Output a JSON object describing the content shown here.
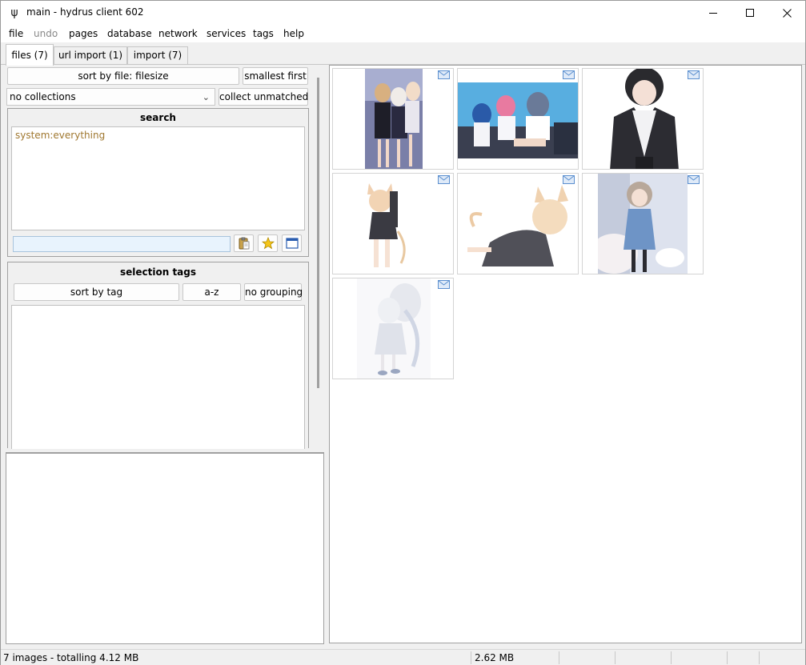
{
  "window": {
    "title": "main - hydrus client 602"
  },
  "menu": [
    "file",
    "undo",
    "pages",
    "database",
    "network",
    "services",
    "tags",
    "help"
  ],
  "tabs": [
    {
      "label": "files (7)",
      "active": true
    },
    {
      "label": "url import (1)",
      "active": false
    },
    {
      "label": "import (7)",
      "active": false
    }
  ],
  "sort": {
    "sort_by_label": "sort by file: filesize",
    "order_label": "smallest first"
  },
  "collect": {
    "selected": "no collections",
    "unmatched_label": "collect unmatched"
  },
  "search": {
    "title": "search",
    "predicate": "system:everything",
    "input_value": ""
  },
  "selection_tags": {
    "title": "selection tags",
    "sort_label": "sort by tag",
    "order_label": "a-z",
    "grouping_label": "no grouping"
  },
  "thumbnails": [
    {
      "name": "thumb-1",
      "colors": [
        "#6a6f9a",
        "#e8e4ee",
        "#2a2a3a"
      ]
    },
    {
      "name": "thumb-2",
      "colors": [
        "#4aa0d8",
        "#e8eef6",
        "#2a3040"
      ]
    },
    {
      "name": "thumb-3",
      "colors": [
        "#ffffff",
        "#2a2a2e",
        "#e8d8d0"
      ]
    },
    {
      "name": "thumb-4",
      "colors": [
        "#ffffff",
        "#3a3a40",
        "#f4d8c0"
      ]
    },
    {
      "name": "thumb-5",
      "colors": [
        "#ffffff",
        "#505058",
        "#f2d8bc"
      ]
    },
    {
      "name": "thumb-6",
      "colors": [
        "#d8dce8",
        "#6a90c0",
        "#b8a898"
      ]
    },
    {
      "name": "thumb-7",
      "colors": [
        "#f6f6f8",
        "#d4d8e4",
        "#c0c8d8"
      ]
    }
  ],
  "status": {
    "summary": "7 images - totalling 4.12 MB",
    "selected_size": "2.62 MB"
  },
  "colors": {
    "predicate": "#a07830",
    "input_bg": "#e8f3fd",
    "mail_icon": "#5b8fcf"
  }
}
